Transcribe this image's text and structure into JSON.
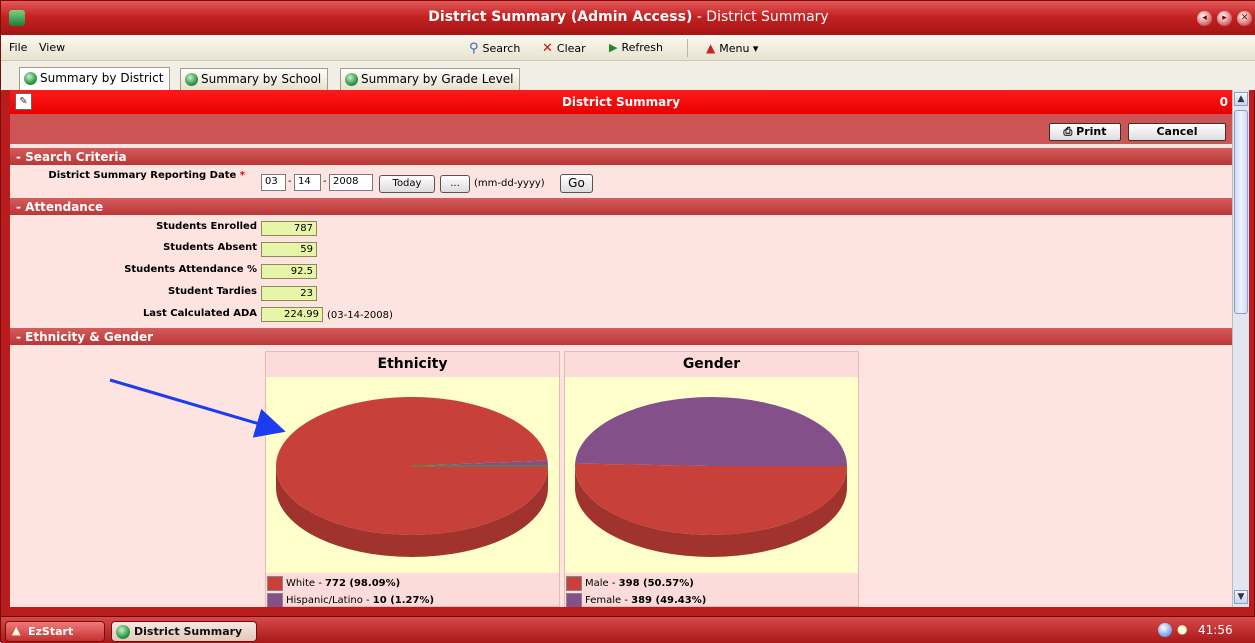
{
  "window": {
    "title_main": "District Summary (Admin Access)",
    "title_sub": " - District Summary",
    "controls": [
      "◂",
      "▸",
      "✕"
    ]
  },
  "menubar": {
    "file": "File",
    "view": "View",
    "search": "Search",
    "clear": "Clear",
    "refresh": "Refresh",
    "menu": "Menu ▾"
  },
  "tabs": [
    {
      "label": "Summary by District"
    },
    {
      "label": "Summary by School"
    },
    {
      "label": "Summary by Grade Level"
    }
  ],
  "header": {
    "title": "District Summary",
    "count": "0"
  },
  "actions": {
    "print": "Print",
    "cancel": "Cancel"
  },
  "search_criteria": {
    "section": "- Search Criteria",
    "label": "District Summary Reporting Date",
    "required": "*",
    "month": "03",
    "day": "14",
    "year": "2008",
    "today": "Today",
    "picker": "...",
    "format": "(mm-dd-yyyy)",
    "go": "Go"
  },
  "attendance": {
    "section": "- Attendance",
    "rows": [
      {
        "label": "Students Enrolled",
        "value": "787"
      },
      {
        "label": "Students Absent",
        "value": "59"
      },
      {
        "label": "Students Attendance %",
        "value": "92.5"
      },
      {
        "label": "Student Tardies",
        "value": "23"
      },
      {
        "label": "Last Calculated ADA",
        "value": "224.99",
        "note": "(03-14-2008)"
      }
    ]
  },
  "ethnicity_gender": {
    "section": "- Ethnicity & Gender"
  },
  "chart_data": [
    {
      "type": "pie",
      "title": "Ethnicity",
      "slices": [
        {
          "label": "White",
          "count": 772,
          "percent": 98.09,
          "color": "#c8403a"
        },
        {
          "label": "Hispanic/Latino",
          "count": 10,
          "percent": 1.27,
          "color": "#83508a"
        }
      ],
      "legend": [
        {
          "name": "White",
          "value": "772 (98.09%)",
          "color": "#c8403a"
        },
        {
          "name": "Hispanic/Latino",
          "value": "10 (1.27%)",
          "color": "#83508a"
        }
      ]
    },
    {
      "type": "pie",
      "title": "Gender",
      "slices": [
        {
          "label": "Male",
          "count": 398,
          "percent": 50.57,
          "color": "#c8403a"
        },
        {
          "label": "Female",
          "count": 389,
          "percent": 49.43,
          "color": "#83508a"
        }
      ],
      "legend": [
        {
          "name": "Male",
          "value": "398 (50.57%)",
          "color": "#c8403a"
        },
        {
          "name": "Female",
          "value": "389 (49.43%)",
          "color": "#83508a"
        }
      ]
    }
  ],
  "taskbar": {
    "start": "EzStart",
    "app": "District Summary",
    "clock": "41:56"
  }
}
